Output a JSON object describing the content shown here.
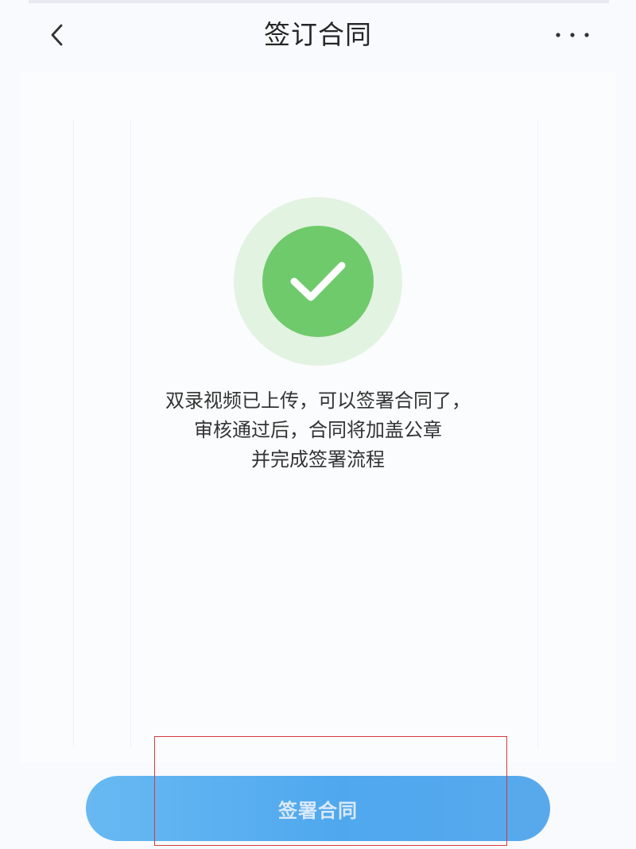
{
  "header": {
    "title": "签订合同",
    "back_icon": "chevron-left-icon",
    "more_icon": "more-dots-icon"
  },
  "status": {
    "icon": "checkmark-icon",
    "color": "#6fca6b",
    "halo_color": "#e2f3e1"
  },
  "message": {
    "line1": "双录视频已上传，可以签署合同了，",
    "line2": "审核通过后，合同将加盖公章",
    "line3": "并完成签署流程"
  },
  "footer": {
    "sign_label": "签署合同",
    "button_color": "#4fa8ee"
  },
  "annotation": {
    "highlight_color": "#d63b3b"
  }
}
